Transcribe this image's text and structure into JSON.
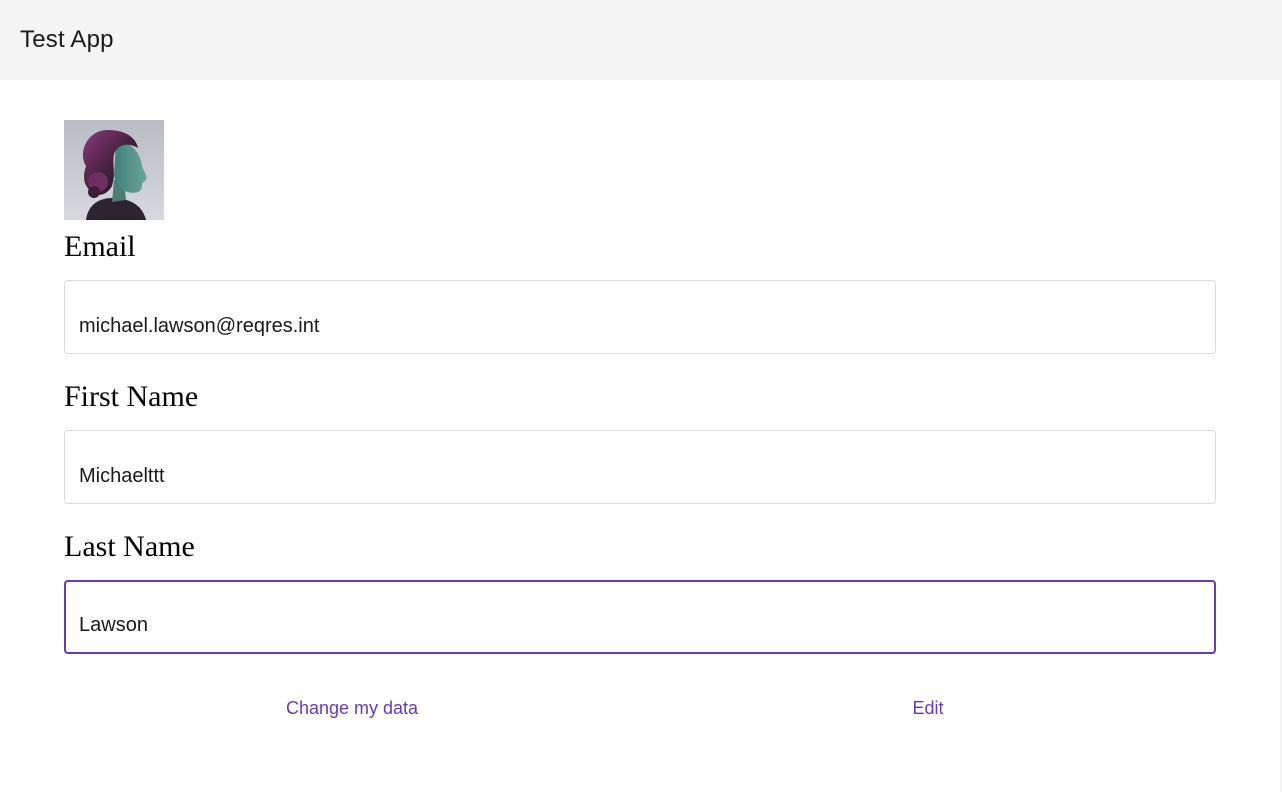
{
  "app": {
    "title": "Test App"
  },
  "profile": {
    "avatar_alt": "avatar"
  },
  "form": {
    "email": {
      "label": "Email",
      "value": "michael.lawson@reqres.int"
    },
    "first_name": {
      "label": "First Name",
      "value": "Michaelttt"
    },
    "last_name": {
      "label": "Last Name",
      "value": "Lawson",
      "focused": true
    }
  },
  "actions": {
    "change_label": "Change my data",
    "edit_label": "Edit"
  },
  "colors": {
    "accent": "#673ab7",
    "toolbar_bg": "#f4f4f4",
    "input_border": "#dcdcdc"
  }
}
